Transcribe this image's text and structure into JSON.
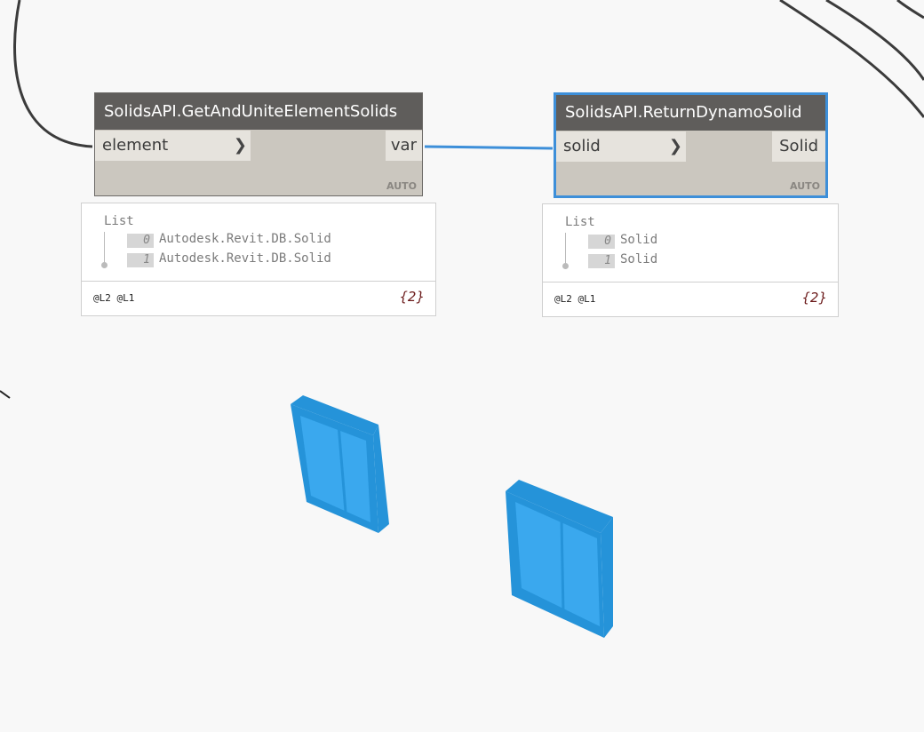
{
  "nodes": [
    {
      "title": "SolidsAPI.GetAndUniteElementSolids",
      "input": "element",
      "output": "var",
      "lacing": "AUTO",
      "preview": {
        "header": "List",
        "items": [
          {
            "index": "0",
            "value": "Autodesk.Revit.DB.Solid"
          },
          {
            "index": "1",
            "value": "Autodesk.Revit.DB.Solid"
          }
        ],
        "levels": "@L2 @L1",
        "count": "{2}"
      }
    },
    {
      "title": "SolidsAPI.ReturnDynamoSolid",
      "input": "solid",
      "output": "Solid",
      "lacing": "AUTO",
      "preview": {
        "header": "List",
        "items": [
          {
            "index": "0",
            "value": "Solid"
          },
          {
            "index": "1",
            "value": "Solid"
          }
        ],
        "levels": "@L2 @L1",
        "count": "{2}"
      }
    }
  ],
  "colors": {
    "selection": "#3d8fd9",
    "geometry": "#2593d9",
    "geometry_face": "#3aa8ee",
    "wire": "#3b3b3b"
  }
}
